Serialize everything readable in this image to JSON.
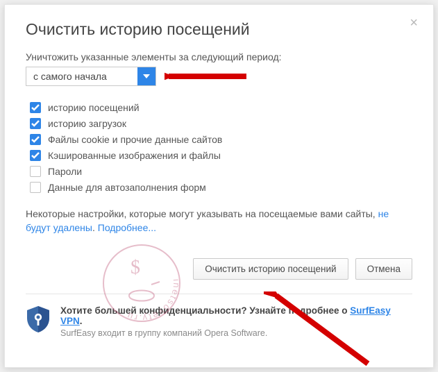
{
  "title": "Очистить историю посещений",
  "period_label": "Уничтожить указанные элементы за следующий период:",
  "select_value": "с самого начала",
  "checkboxes": [
    {
      "label": "историю посещений",
      "checked": true
    },
    {
      "label": "историю загрузок",
      "checked": true
    },
    {
      "label": "Файлы cookie и прочие данные сайтов",
      "checked": true
    },
    {
      "label": "Кэшированные изображения и файлы",
      "checked": true
    },
    {
      "label": "Пароли",
      "checked": false
    },
    {
      "label": "Данные для автозаполнения форм",
      "checked": false
    }
  ],
  "note_pre": "Некоторые настройки, которые могут указывать на посещаемые вами сайты, ",
  "note_link1": "не будут удалены",
  "note_sep": ". ",
  "note_link2": "Подробнее...",
  "btn_clear": "Очистить историю посещений",
  "btn_cancel": "Отмена",
  "promo_title_pre": "Хотите большей конфиденциальности? Узнайте подробнее о ",
  "promo_link": "SurfEasy VPN",
  "promo_title_post": ".",
  "promo_sub": "SurfEasy входит в группу компаний Opera Software.",
  "watermark_text": "inetsovety.ru"
}
